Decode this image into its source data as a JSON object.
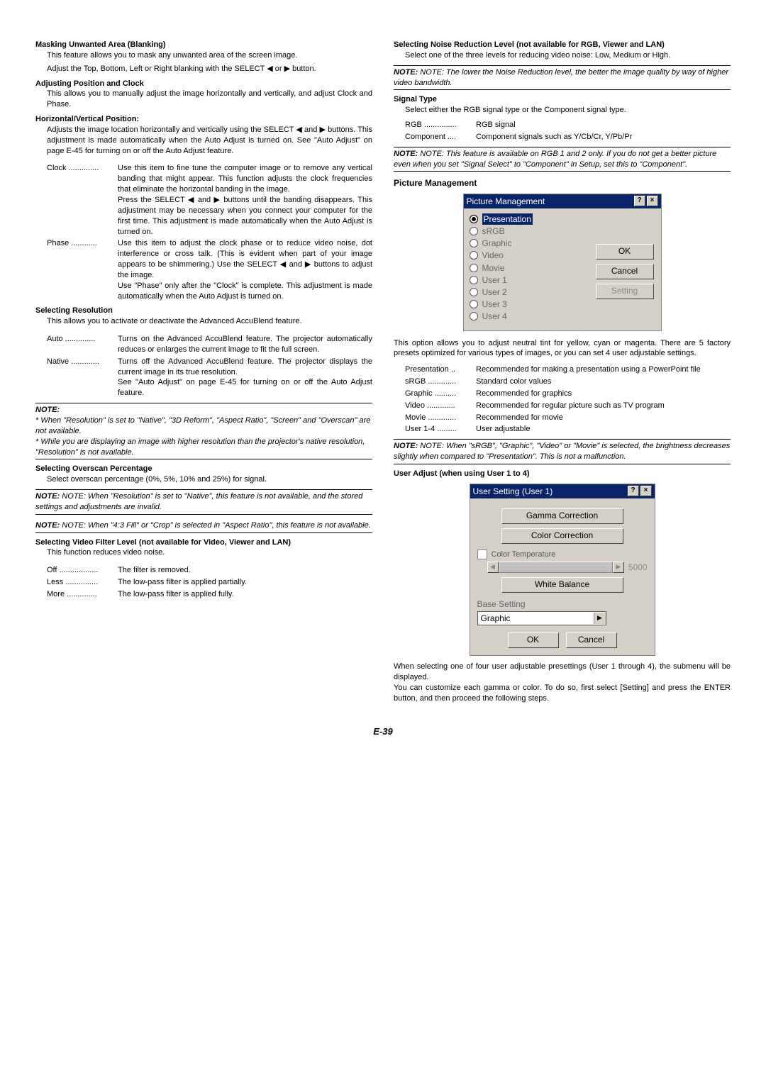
{
  "left": {
    "blanking": {
      "heading": "Masking Unwanted Area (Blanking)",
      "p1": "This feature allows you to mask any unwanted area of the screen image.",
      "p2": "Adjust the Top, Bottom, Left or Right blanking with the SELECT ◀ or ▶ button."
    },
    "posclock": {
      "heading": "Adjusting Position and Clock",
      "p1": "This allows you to manually adjust the image horizontally and vertically, and adjust Clock and Phase."
    },
    "hvpos": {
      "heading": "Horizontal/Vertical Position:",
      "p1": "Adjusts the image location horizontally and vertically using the SELECT ◀ and ▶ buttons. This adjustment is made automatically when the Auto Adjust is turned on. See \"Auto Adjust\" on page E-45 for turning on or off the Auto Adjust feature.",
      "clock_label": "Clock ..............",
      "clock_text": "Use this item to fine tune the computer image or to remove any vertical banding that might appear. This function adjusts the clock frequencies that eliminate the horizontal banding in the image.\nPress the SELECT ◀ and ▶ buttons until the banding disappears. This adjustment may be necessary when you connect your computer for the first time. This adjustment is made automatically when the Auto Adjust is turned on.",
      "phase_label": "Phase ............",
      "phase_text": "Use this item to adjust the clock phase or to reduce video noise, dot interference or cross talk. (This is evident when part of your image appears to be shimmering.) Use the SELECT ◀ and ▶ buttons to adjust the image.\nUse \"Phase\" only after the \"Clock\" is complete. This adjustment is made automatically when the Auto Adjust is turned on."
    },
    "resolution": {
      "heading": "Selecting Resolution",
      "p1": "This allows you to activate or deactivate the Advanced AccuBlend feature.",
      "auto_label": "Auto ..............",
      "auto_text": "Turns on the Advanced AccuBlend feature. The projector automatically reduces or enlarges the current image to fit the full screen.",
      "native_label": "Native .............",
      "native_text": "Turns off the Advanced AccuBlend feature. The projector displays the current image in its true resolution.\nSee \"Auto Adjust\" on page E-45 for turning on or off the Auto Adjust feature.",
      "note_label": "NOTE:",
      "note1": "* When \"Resolution\" is set to \"Native\", \"3D Reform\", \"Aspect Ratio\", \"Screen\" and \"Overscan\" are not available.",
      "note2": "* While you are displaying an image with higher resolution than the projector's native resolution, \"Resolution\" is not available."
    },
    "overscan": {
      "heading": "Selecting Overscan Percentage",
      "p1": "Select overscan percentage (0%, 5%, 10% and 25%) for signal.",
      "note1": "NOTE: When \"Resolution\" is set to \"Native\", this feature is not available, and the stored settings and adjustments are invalid.",
      "note2": "NOTE: When \"4:3 Fill\" or \"Crop\" is selected in \"Aspect Ratio\", this feature is not available."
    },
    "filter": {
      "heading": "Selecting Video Filter Level (not available for Video, Viewer and LAN)",
      "p1": "This function reduces video noise.",
      "off_label": "Off ..................",
      "off_text": "The filter is removed.",
      "less_label": "Less ...............",
      "less_text": "The low-pass filter is applied partially.",
      "more_label": "More ..............",
      "more_text": "The low-pass filter is applied fully."
    }
  },
  "right": {
    "nr": {
      "heading": "Selecting Noise Reduction Level (not available for RGB, Viewer and LAN)",
      "p1": "Select one of the three levels for reducing video noise: Low, Medium or High.",
      "note": "NOTE: The lower the Noise Reduction level, the better the image quality by way of higher video bandwidth."
    },
    "signal": {
      "heading": "Signal Type",
      "p1": "Select either the RGB signal type or the Component signal type.",
      "rgb_label": "RGB ...............",
      "rgb_text": "RGB signal",
      "comp_label": "Component ....",
      "comp_text": "Component signals such as Y/Cb/Cr, Y/Pb/Pr",
      "note": "NOTE: This feature is available on RGB 1 and 2 only. If you do not get a better picture even when you set \"Signal Select\" to \"Component\" in Setup, set this to \"Component\"."
    },
    "pm": {
      "heading": "Picture Management",
      "dialog_title": "Picture Management",
      "opts": [
        "Presentation",
        "sRGB",
        "Graphic",
        "Video",
        "Movie",
        "User 1",
        "User 2",
        "User 3",
        "User 4"
      ],
      "ok": "OK",
      "cancel": "Cancel",
      "setting": "Setting",
      "desc": "This option allows you to adjust neutral tint for yellow, cyan or magenta. There are 5 factory presets optimized for various types of images, or you can set 4 user adjustable settings.",
      "rows": [
        {
          "label": "Presentation ..",
          "text": "Recommended for making a presentation using a PowerPoint file"
        },
        {
          "label": "sRGB .............",
          "text": "Standard color values"
        },
        {
          "label": "Graphic ..........",
          "text": "Recommended for graphics"
        },
        {
          "label": "Video .............",
          "text": "Recommended for regular picture such as TV program"
        },
        {
          "label": "Movie .............",
          "text": "Recommended for movie"
        },
        {
          "label": "User 1-4 .........",
          "text": "User adjustable"
        }
      ],
      "note": "NOTE: When \"sRGB\", \"Graphic\", \"Video\" or \"Movie\" is selected, the brightness decreases slightly when compared to \"Presentation\". This is not a malfunction."
    },
    "user": {
      "heading": "User Adjust (when using User 1 to 4)",
      "dialog_title": "User Setting (User 1)",
      "gamma": "Gamma Correction",
      "colorc": "Color Correction",
      "colortemp": "Color Temperature",
      "ct_value": "5000",
      "wb": "White Balance",
      "base": "Base Setting",
      "base_value": "Graphic",
      "ok": "OK",
      "cancel": "Cancel",
      "p1": "When selecting one of four user adjustable presettings (User 1 through 4), the submenu will be displayed.",
      "p2": "You can customize each gamma or color. To do so, first select [Setting] and press the ENTER button, and then proceed the following steps."
    }
  },
  "page": "E-39"
}
